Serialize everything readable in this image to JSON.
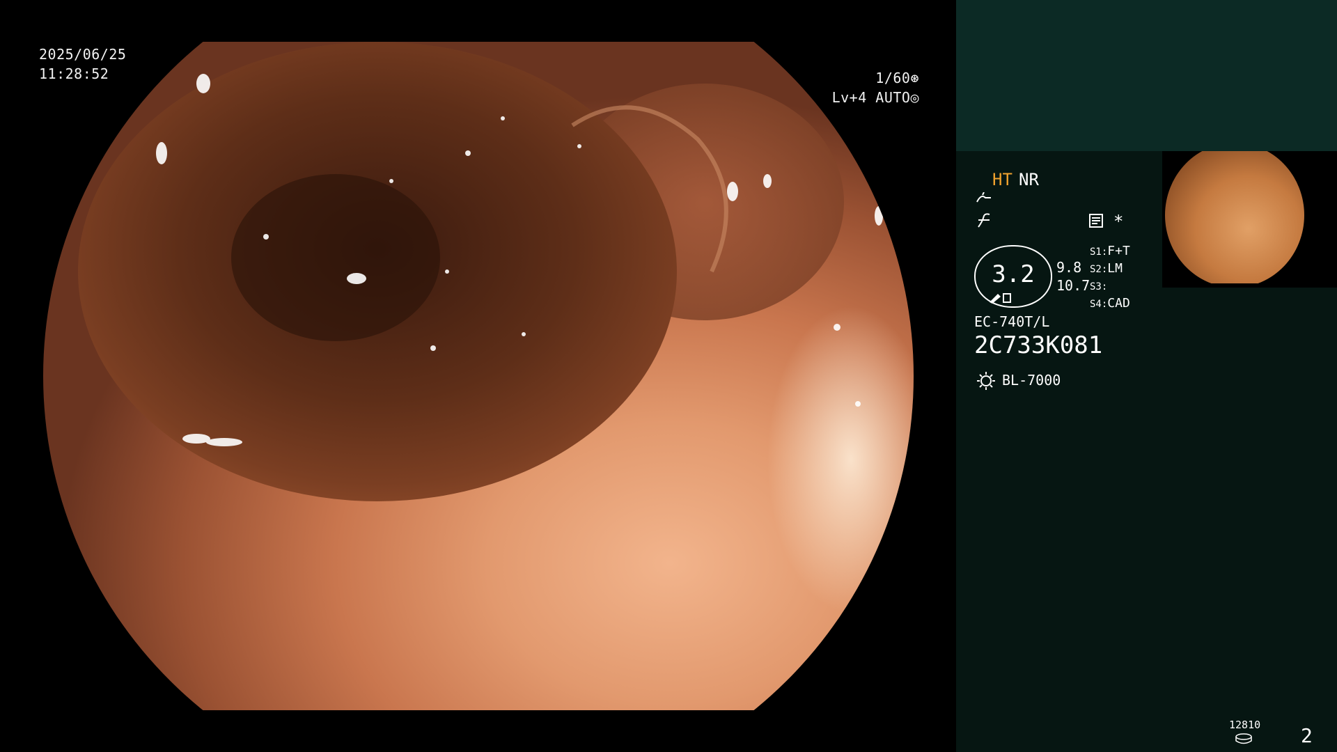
{
  "overlay": {
    "date": "2025/06/25",
    "time": "11:28:52",
    "shutter": "1/60",
    "level": "Lv+4 AUTO"
  },
  "panel": {
    "ht_label": "HT",
    "nr_label": "NR",
    "gauge_value": "3.2",
    "gauge_num1": "9.8",
    "gauge_num2": "10.7",
    "settings": [
      {
        "key": "S1",
        "value": "F+T"
      },
      {
        "key": "S2",
        "value": "LM"
      },
      {
        "key": "S3",
        "value": ""
      },
      {
        "key": "S4",
        "value": "CAD"
      }
    ],
    "scope_model": "EC-740T/L",
    "scope_serial": "2C733K081",
    "light_source": "BL-7000",
    "star": "*"
  },
  "footer": {
    "counter": "12810",
    "page": "2"
  },
  "colors": {
    "panel_bg": "#061612",
    "panel_top": "#0c2a25",
    "accent_orange": "#f0a22e"
  }
}
